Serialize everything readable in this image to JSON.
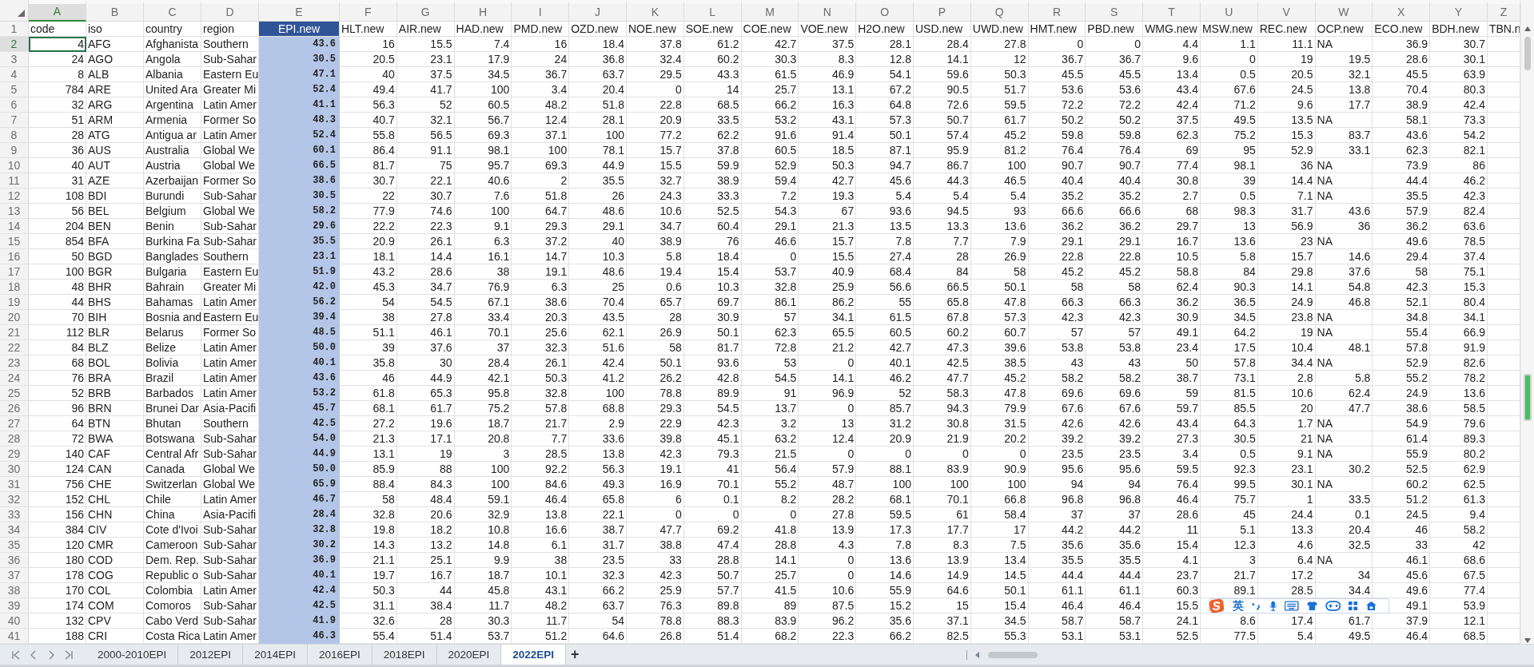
{
  "columns": [
    {
      "letter": "A",
      "title": "code",
      "kind": "number",
      "selected": false,
      "active": true
    },
    {
      "letter": "B",
      "title": "iso",
      "kind": "text",
      "selected": false,
      "active": false
    },
    {
      "letter": "C",
      "title": "country",
      "kind": "text",
      "selected": false,
      "active": false
    },
    {
      "letter": "D",
      "title": "region",
      "kind": "text",
      "selected": false,
      "active": false
    },
    {
      "letter": "E",
      "title": "EPI.new",
      "kind": "score",
      "selected": true,
      "active": false
    },
    {
      "letter": "F",
      "title": "HLT.new",
      "kind": "number",
      "selected": false,
      "active": false
    },
    {
      "letter": "G",
      "title": "AIR.new",
      "kind": "number",
      "selected": false,
      "active": false
    },
    {
      "letter": "H",
      "title": "HAD.new",
      "kind": "number",
      "selected": false,
      "active": false
    },
    {
      "letter": "I",
      "title": "PMD.new",
      "kind": "number",
      "selected": false,
      "active": false
    },
    {
      "letter": "J",
      "title": "OZD.new",
      "kind": "number",
      "selected": false,
      "active": false
    },
    {
      "letter": "K",
      "title": "NOE.new",
      "kind": "number",
      "selected": false,
      "active": false
    },
    {
      "letter": "L",
      "title": "SOE.new",
      "kind": "number",
      "selected": false,
      "active": false
    },
    {
      "letter": "M",
      "title": "COE.new",
      "kind": "number",
      "selected": false,
      "active": false
    },
    {
      "letter": "N",
      "title": "VOE.new",
      "kind": "number",
      "selected": false,
      "active": false
    },
    {
      "letter": "O",
      "title": "H2O.new",
      "kind": "number",
      "selected": false,
      "active": false
    },
    {
      "letter": "P",
      "title": "USD.new",
      "kind": "number",
      "selected": false,
      "active": false
    },
    {
      "letter": "Q",
      "title": "UWD.new",
      "kind": "number",
      "selected": false,
      "active": false
    },
    {
      "letter": "R",
      "title": "HMT.new",
      "kind": "number",
      "selected": false,
      "active": false
    },
    {
      "letter": "S",
      "title": "PBD.new",
      "kind": "number",
      "selected": false,
      "active": false
    },
    {
      "letter": "T",
      "title": "WMG.new",
      "kind": "number",
      "selected": false,
      "active": false
    },
    {
      "letter": "U",
      "title": "MSW.new",
      "kind": "number",
      "selected": false,
      "active": false
    },
    {
      "letter": "V",
      "title": "REC.new",
      "kind": "number",
      "selected": false,
      "active": false
    },
    {
      "letter": "W",
      "title": "OCP.new",
      "kind": "number",
      "selected": false,
      "active": false
    },
    {
      "letter": "X",
      "title": "ECO.new",
      "kind": "number",
      "selected": false,
      "active": false
    },
    {
      "letter": "Y",
      "title": "BDH.new",
      "kind": "number",
      "selected": false,
      "active": false
    },
    {
      "letter": "Z",
      "title": "TBN.n",
      "kind": "text",
      "selected": false,
      "active": false
    }
  ],
  "title_row_number": "1",
  "rows": [
    {
      "number": "2",
      "active": true,
      "cells": [
        "4",
        "AFG",
        "Afghanista",
        "Southern",
        "43.6",
        "16",
        "15.5",
        "7.4",
        "16",
        "18.4",
        "37.8",
        "61.2",
        "42.7",
        "37.5",
        "28.1",
        "28.4",
        "27.8",
        "0",
        "0",
        "4.4",
        "1.1",
        "11.1",
        {
          "text": "NA",
          "kind": "text"
        },
        "36.9",
        "30.7"
      ]
    },
    {
      "number": "3",
      "active": false,
      "cells": [
        "24",
        "AGO",
        "Angola",
        "Sub-Sahar",
        "30.5",
        "20.5",
        "23.1",
        "17.9",
        "24",
        "36.8",
        "32.4",
        "60.2",
        "30.3",
        "8.3",
        "12.8",
        "14.1",
        "12",
        "36.7",
        "36.7",
        "9.6",
        "0",
        "19",
        "19.5",
        "28.6",
        "30.1"
      ]
    },
    {
      "number": "4",
      "active": false,
      "cells": [
        "8",
        "ALB",
        "Albania",
        "Eastern Eu",
        "47.1",
        "40",
        "37.5",
        "34.5",
        "36.7",
        "63.7",
        "29.5",
        "43.3",
        "61.5",
        "46.9",
        "54.1",
        "59.6",
        "50.3",
        "45.5",
        "45.5",
        "13.4",
        "0.5",
        "20.5",
        "32.1",
        "45.5",
        "63.9"
      ]
    },
    {
      "number": "5",
      "active": false,
      "cells": [
        "784",
        "ARE",
        "United Ara",
        "Greater Mi",
        "52.4",
        "49.4",
        "41.7",
        "100",
        "3.4",
        "20.4",
        "0",
        "14",
        "25.7",
        "13.1",
        "67.2",
        "90.5",
        "51.7",
        "53.6",
        "53.6",
        "43.4",
        "67.6",
        "24.5",
        "13.8",
        "70.4",
        "80.3"
      ]
    },
    {
      "number": "6",
      "active": false,
      "cells": [
        "32",
        "ARG",
        "Argentina",
        "Latin Amer",
        "41.1",
        "56.3",
        "52",
        "60.5",
        "48.2",
        "51.8",
        "22.8",
        "68.5",
        "66.2",
        "16.3",
        "64.8",
        "72.6",
        "59.5",
        "72.2",
        "72.2",
        "42.4",
        "71.2",
        "9.6",
        "17.7",
        "38.9",
        "42.4"
      ]
    },
    {
      "number": "7",
      "active": false,
      "cells": [
        "51",
        "ARM",
        "Armenia",
        "Former So",
        "48.3",
        "40.7",
        "32.1",
        "56.7",
        "12.4",
        "28.1",
        "20.9",
        "33.5",
        "53.2",
        "43.1",
        "57.3",
        "50.7",
        "61.7",
        "50.2",
        "50.2",
        "37.5",
        "49.5",
        "13.5",
        {
          "text": "NA",
          "kind": "text"
        },
        "58.1",
        "73.3"
      ]
    },
    {
      "number": "8",
      "active": false,
      "cells": [
        "28",
        "ATG",
        "Antigua ar",
        "Latin Amer",
        "52.4",
        "55.8",
        "56.5",
        "69.3",
        "37.1",
        "100",
        "77.2",
        "62.2",
        "91.6",
        "91.4",
        "50.1",
        "57.4",
        "45.2",
        "59.8",
        "59.8",
        "62.3",
        "75.2",
        "15.3",
        "83.7",
        "43.6",
        "54.2"
      ]
    },
    {
      "number": "9",
      "active": false,
      "cells": [
        "36",
        "AUS",
        "Australia",
        "Global We",
        "60.1",
        "86.4",
        "91.1",
        "98.1",
        "100",
        "78.1",
        "15.7",
        "37.8",
        "60.5",
        "18.5",
        "87.1",
        "95.9",
        "81.2",
        "76.4",
        "76.4",
        "69",
        "95",
        "52.9",
        "33.1",
        "62.3",
        "82.1"
      ]
    },
    {
      "number": "10",
      "active": false,
      "cells": [
        "40",
        "AUT",
        "Austria",
        "Global We",
        "66.5",
        "81.7",
        "75",
        "95.7",
        "69.3",
        "44.9",
        "15.5",
        "59.9",
        "52.9",
        "50.3",
        "94.7",
        "86.7",
        "100",
        "90.7",
        "90.7",
        "77.4",
        "98.1",
        "36",
        {
          "text": "NA",
          "kind": "text"
        },
        "73.9",
        "86"
      ]
    },
    {
      "number": "11",
      "active": false,
      "cells": [
        "31",
        "AZE",
        "Azerbaijan",
        "Former So",
        "38.6",
        "30.7",
        "22.1",
        "40.6",
        "2",
        "35.5",
        "32.7",
        "38.9",
        "59.4",
        "42.7",
        "45.6",
        "44.3",
        "46.5",
        "40.4",
        "40.4",
        "30.8",
        "39",
        "14.4",
        {
          "text": "NA",
          "kind": "text"
        },
        "44.4",
        "46.2"
      ]
    },
    {
      "number": "12",
      "active": false,
      "cells": [
        "108",
        "BDI",
        "Burundi",
        "Sub-Sahar",
        "30.5",
        "22",
        "30.7",
        "7.6",
        "51.8",
        "26",
        "24.3",
        "33.3",
        "7.2",
        "19.3",
        "5.4",
        "5.4",
        "5.4",
        "35.2",
        "35.2",
        "2.7",
        "0.5",
        "7.1",
        {
          "text": "NA",
          "kind": "text"
        },
        "35.5",
        "42.3"
      ]
    },
    {
      "number": "13",
      "active": false,
      "cells": [
        "56",
        "BEL",
        "Belgium",
        "Global We",
        "58.2",
        "77.9",
        "74.6",
        "100",
        "64.7",
        "48.6",
        "10.6",
        "52.5",
        "54.3",
        "67",
        "93.6",
        "94.5",
        "93",
        "66.6",
        "66.6",
        "68",
        "98.3",
        "31.7",
        "43.6",
        "57.9",
        "82.4"
      ]
    },
    {
      "number": "14",
      "active": false,
      "cells": [
        "204",
        "BEN",
        "Benin",
        "Sub-Sahar",
        "29.6",
        "22.2",
        "22.3",
        "9.1",
        "29.3",
        "29.1",
        "34.7",
        "60.4",
        "29.1",
        "21.3",
        "13.5",
        "13.3",
        "13.6",
        "36.2",
        "36.2",
        "29.7",
        "13",
        "56.9",
        "36",
        "36.2",
        "63.6"
      ]
    },
    {
      "number": "15",
      "active": false,
      "cells": [
        "854",
        "BFA",
        "Burkina Fa",
        "Sub-Sahar",
        "35.5",
        "20.9",
        "26.1",
        "6.3",
        "37.2",
        "40",
        "38.9",
        "76",
        "46.6",
        "15.7",
        "7.8",
        "7.7",
        "7.9",
        "29.1",
        "29.1",
        "16.7",
        "13.6",
        "23",
        {
          "text": "NA",
          "kind": "text"
        },
        "49.6",
        "78.5"
      ]
    },
    {
      "number": "16",
      "active": false,
      "cells": [
        "50",
        "BGD",
        "Banglades",
        "Southern",
        "23.1",
        "18.1",
        "14.4",
        "16.1",
        "14.7",
        "10.3",
        "5.8",
        "18.4",
        "0",
        "15.5",
        "27.4",
        "28",
        "26.9",
        "22.8",
        "22.8",
        "10.5",
        "5.8",
        "15.7",
        "14.6",
        "29.4",
        "37.4"
      ]
    },
    {
      "number": "17",
      "active": false,
      "cells": [
        "100",
        "BGR",
        "Bulgaria",
        "Eastern Eu",
        "51.9",
        "43.2",
        "28.6",
        "38",
        "19.1",
        "48.6",
        "19.4",
        "15.4",
        "53.7",
        "40.9",
        "68.4",
        "84",
        "58",
        "45.2",
        "45.2",
        "58.8",
        "84",
        "29.8",
        "37.6",
        "58",
        "75.1"
      ]
    },
    {
      "number": "18",
      "active": false,
      "cells": [
        "48",
        "BHR",
        "Bahrain",
        "Greater Mi",
        "42.0",
        "45.3",
        "34.7",
        "76.9",
        "6.3",
        "25",
        "0.6",
        "10.3",
        "32.8",
        "25.9",
        "56.6",
        "66.5",
        "50.1",
        "58",
        "58",
        "62.4",
        "90.3",
        "14.1",
        "54.8",
        "42.3",
        "15.3"
      ]
    },
    {
      "number": "19",
      "active": false,
      "cells": [
        "44",
        "BHS",
        "Bahamas",
        "Latin Amer",
        "56.2",
        "54",
        "54.5",
        "67.1",
        "38.6",
        "70.4",
        "65.7",
        "69.7",
        "86.1",
        "86.2",
        "55",
        "65.8",
        "47.8",
        "66.3",
        "66.3",
        "36.2",
        "36.5",
        "24.9",
        "46.8",
        "52.1",
        "80.4"
      ]
    },
    {
      "number": "20",
      "active": false,
      "cells": [
        "70",
        "BIH",
        "Bosnia and",
        "Eastern Eu",
        "39.4",
        "38",
        "27.8",
        "33.4",
        "20.3",
        "43.5",
        "28",
        "30.9",
        "57",
        "34.1",
        "61.5",
        "67.8",
        "57.3",
        "42.3",
        "42.3",
        "30.9",
        "34.5",
        "23.8",
        {
          "text": "NA",
          "kind": "text"
        },
        "34.8",
        "34.1"
      ]
    },
    {
      "number": "21",
      "active": false,
      "cells": [
        "112",
        "BLR",
        "Belarus",
        "Former So",
        "48.5",
        "51.1",
        "46.1",
        "70.1",
        "25.6",
        "62.1",
        "26.9",
        "50.1",
        "62.3",
        "65.5",
        "60.5",
        "60.2",
        "60.7",
        "57",
        "57",
        "49.1",
        "64.2",
        "19",
        {
          "text": "NA",
          "kind": "text"
        },
        "55.4",
        "66.9"
      ]
    },
    {
      "number": "22",
      "active": false,
      "cells": [
        "84",
        "BLZ",
        "Belize",
        "Latin Amer",
        "50.0",
        "39",
        "37.6",
        "37",
        "32.3",
        "51.6",
        "58",
        "81.7",
        "72.8",
        "21.2",
        "42.7",
        "47.3",
        "39.6",
        "53.8",
        "53.8",
        "23.4",
        "17.5",
        "10.4",
        "48.1",
        "57.8",
        "91.9"
      ]
    },
    {
      "number": "23",
      "active": false,
      "cells": [
        "68",
        "BOL",
        "Bolivia",
        "Latin Amer",
        "40.1",
        "35.8",
        "30",
        "28.4",
        "26.1",
        "42.4",
        "50.1",
        "93.6",
        "53",
        "0",
        "40.1",
        "42.5",
        "38.5",
        "43",
        "43",
        "50",
        "57.8",
        "34.4",
        {
          "text": "NA",
          "kind": "text"
        },
        "52.9",
        "82.6"
      ]
    },
    {
      "number": "24",
      "active": false,
      "cells": [
        "76",
        "BRA",
        "Brazil",
        "Latin Amer",
        "43.6",
        "46",
        "44.9",
        "42.1",
        "50.3",
        "41.2",
        "26.2",
        "42.8",
        "54.5",
        "14.1",
        "46.2",
        "47.7",
        "45.2",
        "58.2",
        "58.2",
        "38.7",
        "73.1",
        "2.8",
        "5.8",
        "55.2",
        "78.2"
      ]
    },
    {
      "number": "25",
      "active": false,
      "cells": [
        "52",
        "BRB",
        "Barbados",
        "Latin Amer",
        "53.2",
        "61.8",
        "65.3",
        "95.8",
        "32.8",
        "100",
        "78.8",
        "89.9",
        "91",
        "96.9",
        "52",
        "58.3",
        "47.8",
        "69.6",
        "69.6",
        "59",
        "81.5",
        "10.6",
        "62.4",
        "24.9",
        "13.6"
      ]
    },
    {
      "number": "26",
      "active": false,
      "cells": [
        "96",
        "BRN",
        "Brunei Dar",
        "Asia-Pacifi",
        "45.7",
        "68.1",
        "61.7",
        "75.2",
        "57.8",
        "68.8",
        "29.3",
        "54.5",
        "13.7",
        "0",
        "85.7",
        "94.3",
        "79.9",
        "67.6",
        "67.6",
        "59.7",
        "85.5",
        "20",
        "47.7",
        "38.6",
        "58.5"
      ]
    },
    {
      "number": "27",
      "active": false,
      "cells": [
        "64",
        "BTN",
        "Bhutan",
        "Southern",
        "42.5",
        "27.2",
        "19.6",
        "18.7",
        "21.7",
        "2.9",
        "22.9",
        "42.3",
        "3.2",
        "13",
        "31.2",
        "30.8",
        "31.5",
        "42.6",
        "42.6",
        "43.4",
        "64.3",
        "1.7",
        {
          "text": "NA",
          "kind": "text"
        },
        "54.9",
        "79.6"
      ]
    },
    {
      "number": "28",
      "active": false,
      "cells": [
        "72",
        "BWA",
        "Botswana",
        "Sub-Sahar",
        "54.0",
        "21.3",
        "17.1",
        "20.8",
        "7.7",
        "33.6",
        "39.8",
        "45.1",
        "63.2",
        "12.4",
        "20.9",
        "21.9",
        "20.2",
        "39.2",
        "39.2",
        "27.3",
        "30.5",
        "21",
        {
          "text": "NA",
          "kind": "text"
        },
        "61.4",
        "89.3"
      ]
    },
    {
      "number": "29",
      "active": false,
      "cells": [
        "140",
        "CAF",
        "Central Afr",
        "Sub-Sahar",
        "44.9",
        "13.1",
        "19",
        "3",
        "28.5",
        "13.8",
        "42.3",
        "79.3",
        "21.5",
        "0",
        "0",
        "0",
        "0",
        "23.5",
        "23.5",
        "3.4",
        "0.5",
        "9.1",
        {
          "text": "NA",
          "kind": "text"
        },
        "55.9",
        "80.2"
      ]
    },
    {
      "number": "30",
      "active": false,
      "cells": [
        "124",
        "CAN",
        "Canada",
        "Global We",
        "50.0",
        "85.9",
        "88",
        "100",
        "92.2",
        "56.3",
        "19.1",
        "41",
        "56.4",
        "57.9",
        "88.1",
        "83.9",
        "90.9",
        "95.6",
        "95.6",
        "59.5",
        "92.3",
        "23.1",
        "30.2",
        "52.5",
        "62.9"
      ]
    },
    {
      "number": "31",
      "active": false,
      "cells": [
        "756",
        "CHE",
        "Switzerlan",
        "Global We",
        "65.9",
        "88.4",
        "84.3",
        "100",
        "84.6",
        "49.3",
        "16.9",
        "70.1",
        "55.2",
        "48.7",
        "100",
        "100",
        "100",
        "94",
        "94",
        "76.4",
        "99.5",
        "30.1",
        {
          "text": "NA",
          "kind": "text"
        },
        "60.2",
        "62.5"
      ]
    },
    {
      "number": "32",
      "active": false,
      "cells": [
        "152",
        "CHL",
        "Chile",
        "Latin Amer",
        "46.7",
        "58",
        "48.4",
        "59.1",
        "46.4",
        "65.8",
        "6",
        "0.1",
        "8.2",
        "28.2",
        "68.1",
        "70.1",
        "66.8",
        "96.8",
        "96.8",
        "46.4",
        "75.7",
        "1",
        "33.5",
        "51.2",
        "61.3"
      ]
    },
    {
      "number": "33",
      "active": false,
      "cells": [
        "156",
        "CHN",
        "China",
        "Asia-Pacifi",
        "28.4",
        "32.8",
        "20.6",
        "32.9",
        "13.8",
        "22.1",
        "0",
        "0",
        "0",
        "27.8",
        "59.5",
        "61",
        "58.4",
        "37",
        "37",
        "28.6",
        "45",
        "24.4",
        "0.1",
        "24.5",
        "9.4"
      ]
    },
    {
      "number": "34",
      "active": false,
      "cells": [
        "384",
        "CIV",
        "Cote d'Ivoi",
        "Sub-Sahar",
        "32.8",
        "19.8",
        "18.2",
        "10.8",
        "16.6",
        "38.7",
        "47.7",
        "69.2",
        "41.8",
        "13.9",
        "17.3",
        "17.7",
        "17",
        "44.2",
        "44.2",
        "11",
        "5.1",
        "13.3",
        "20.4",
        "46",
        "58.2"
      ]
    },
    {
      "number": "35",
      "active": false,
      "cells": [
        "120",
        "CMR",
        "Cameroon",
        "Sub-Sahar",
        "30.2",
        "14.3",
        "13.2",
        "14.8",
        "6.1",
        "31.7",
        "38.8",
        "47.4",
        "28.8",
        "4.3",
        "7.8",
        "8.3",
        "7.5",
        "35.6",
        "35.6",
        "15.4",
        "12.3",
        "4.6",
        "32.5",
        "33",
        "42"
      ]
    },
    {
      "number": "36",
      "active": false,
      "cells": [
        "180",
        "COD",
        "Dem. Rep.",
        "Sub-Sahar",
        "36.9",
        "21.1",
        "25.1",
        "9.9",
        "38",
        "23.5",
        "33",
        "28.8",
        "14.1",
        "0",
        "13.6",
        "13.9",
        "13.4",
        "35.5",
        "35.5",
        "4.1",
        "3",
        "6.4",
        {
          "text": "NA",
          "kind": "text"
        },
        "46.1",
        "68.6"
      ]
    },
    {
      "number": "37",
      "active": false,
      "cells": [
        "178",
        "COG",
        "Republic o",
        "Sub-Sahar",
        "40.1",
        "19.7",
        "16.7",
        "18.7",
        "10.1",
        "32.3",
        "42.3",
        "50.7",
        "25.7",
        "0",
        "14.6",
        "14.9",
        "14.5",
        "44.4",
        "44.4",
        "23.7",
        "21.7",
        "17.2",
        "34",
        "45.6",
        "67.5"
      ]
    },
    {
      "number": "38",
      "active": false,
      "cells": [
        "170",
        "COL",
        "Colombia",
        "Latin Amer",
        "42.4",
        "50.3",
        "44",
        "45.8",
        "43.1",
        "66.2",
        "25.9",
        "57.7",
        "41.5",
        "10.6",
        "55.9",
        "64.6",
        "50.1",
        "61.1",
        "61.1",
        "60.3",
        "89.1",
        "28.5",
        "34.4",
        "49.6",
        "77.4"
      ]
    },
    {
      "number": "39",
      "active": false,
      "cells": [
        "174",
        "COM",
        "Comoros",
        "Sub-Sahar",
        "42.5",
        "31.1",
        "38.4",
        "11.7",
        "48.2",
        "63.7",
        "76.3",
        "89.8",
        "89",
        "87.5",
        "15.2",
        "15",
        "15.4",
        "46.4",
        "46.4",
        "15.5",
        null,
        null,
        null,
        "49.1",
        "53.9"
      ]
    },
    {
      "number": "40",
      "active": false,
      "cells": [
        "132",
        "CPV",
        "Cabo Verd",
        "Sub-Sahar",
        "41.9",
        "32.6",
        "28",
        "30.3",
        "11.7",
        "54",
        "78.8",
        "88.3",
        "83.9",
        "96.2",
        "35.6",
        "37.1",
        "34.5",
        "58.7",
        "58.7",
        "24.1",
        "8.6",
        "17.4",
        "61.7",
        "37.9",
        "12.1"
      ]
    },
    {
      "number": "41",
      "active": false,
      "cells": [
        "188",
        "CRI",
        "Costa Rica",
        "Latin Amer",
        "46.3",
        "55.4",
        "51.4",
        "53.7",
        "51.2",
        "64.6",
        "26.8",
        "51.4",
        "68.2",
        "22.3",
        "66.2",
        "82.5",
        "55.3",
        "53.1",
        "53.1",
        "52.5",
        "77.5",
        "5.4",
        "49.5",
        "46.4",
        "68.5"
      ]
    }
  ],
  "sheet_tabs": [
    {
      "label": "2000-2010EPI",
      "selected": false
    },
    {
      "label": "2012EPI",
      "selected": false
    },
    {
      "label": "2014EPI",
      "selected": false
    },
    {
      "label": "2016EPI",
      "selected": false
    },
    {
      "label": "2018EPI",
      "selected": false
    },
    {
      "label": "2020EPI",
      "selected": false
    },
    {
      "label": "2022EPI",
      "selected": true
    }
  ],
  "add_sheet_label": "+",
  "ime_toolbar": {
    "mode": "英"
  }
}
